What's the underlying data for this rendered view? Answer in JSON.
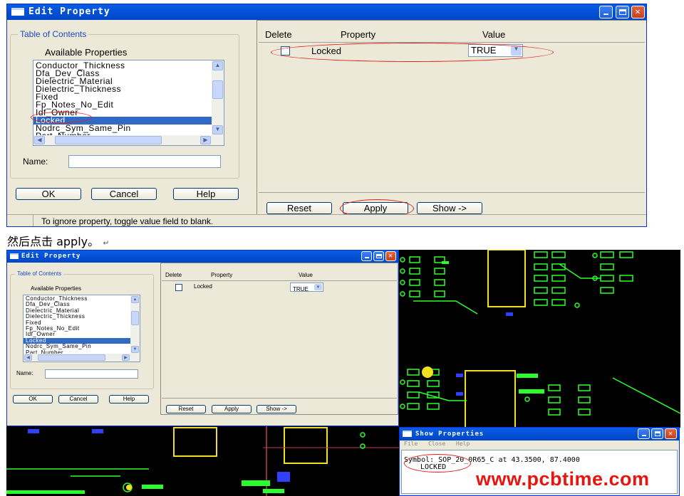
{
  "dialog": {
    "title": "Edit Property",
    "toc_label": "Table of Contents",
    "available_label": "Available Properties",
    "properties": [
      "Conductor_Thickness",
      "Dfa_Dev_Class",
      "Dielectric_Material",
      "Dielectric_Thickness",
      "Fixed",
      "Fp_Notes_No_Edit",
      "Idf_Owner",
      "Locked",
      "Nodrc_Sym_Same_Pin",
      "Part_Number"
    ],
    "selected_property": "Locked",
    "name_label": "Name:",
    "name_value": "",
    "ok_label": "OK",
    "cancel_label": "Cancel",
    "help_label": "Help",
    "columns": {
      "delete": "Delete",
      "property": "Property",
      "value": "Value"
    },
    "row": {
      "property": "Locked",
      "value": "TRUE"
    },
    "reset_label": "Reset",
    "apply_label": "Apply",
    "show_label": "Show ->",
    "status": "To ignore property, toggle value field to blank."
  },
  "caption": {
    "text": "然后点击 apply。",
    "return_mark": "↵"
  },
  "show_window": {
    "title": "Show Properties",
    "menu": [
      "File",
      "Close",
      "Help"
    ],
    "symbol_line": "Symbol: SOP_20_0R65_C at 43.3500, 87.4000",
    "locked_line": "LOCKED"
  },
  "watermark": "www.pcbtime.com",
  "colors": {
    "title_blue": "#0453d8",
    "annotation_red": "#e0201b",
    "pcb_green": "#2bff2b",
    "pcb_yellow": "#f0e020",
    "pcb_blue": "#3040ff"
  }
}
